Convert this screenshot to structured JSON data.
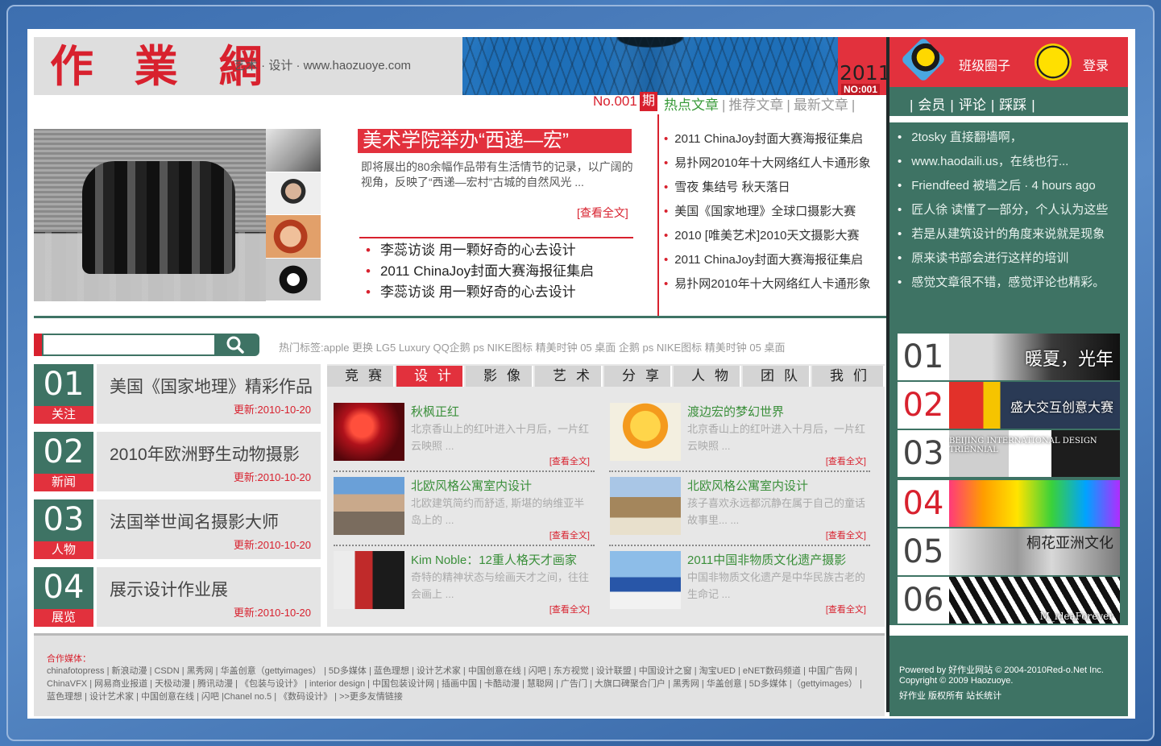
{
  "header": {
    "logo": "作 業 網",
    "tagline": "艺术 · 设计 · www.haozuoye.com",
    "issue_year": "2011",
    "issue_no": "NO:001",
    "club_label": "班级圈子",
    "login_label": "登录"
  },
  "nav": {
    "issue_label": "No.001",
    "qi": "期",
    "links": [
      "热点文章",
      "推荐文章",
      "最新文章"
    ]
  },
  "feature": {
    "title": "美术学院举办“西递—宏”",
    "desc": "即将展出的80余幅作品带有生活情节的记录，以广阔的视角，反映了“西递—宏村”古城的自然风光 ...",
    "more": "[查看全文]",
    "list": [
      "李蕊访谈 用一颗好奇的心去设计",
      "2011 ChinaJoy封面大赛海报征集启",
      "李蕊访谈 用一颗好奇的心去设计"
    ]
  },
  "hot_list": [
    "2011 ChinaJoy封面大赛海报征集启",
    "易扑网2010年十大网络红人卡通形象",
    "雪夜 集结号 秋天落日",
    "美国《国家地理》全球口摄影大赛",
    "2010 [唯美艺术]2010天文摄影大赛",
    "2011 ChinaJoy封面大赛海报征集启",
    "易扑网2010年十大网络红人卡通形象"
  ],
  "member_panel": {
    "tabs": [
      "会员",
      "评论",
      "踩踩"
    ],
    "items": [
      "2tosky 直接翻墙啊，",
      "www.haodaili.us，在线也行...",
      "Friendfeed 被墙之后 · 4 hours ago",
      "匠人徐 读懂了一部分，个人认为这些",
      "若是从建筑设计的角度来说就是现象",
      "原来读书部会进行这样的培训",
      "感觉文章很不错，感觉评论也精彩。"
    ]
  },
  "search": {
    "placeholder": "",
    "hot_tags": "热门标签:apple 更换 LG5 Luxury QQ企鹅 ps NIKE图标 精美时钟 05 桌面 企鹅 ps NIKE图标 精美时钟 05 桌面"
  },
  "numbered": [
    {
      "n": "01",
      "tag": "关注",
      "title": "美国《国家地理》精彩作品",
      "date": "更新:2010-10-20"
    },
    {
      "n": "02",
      "tag": "新闻",
      "title": "2010年欧洲野生动物摄影",
      "date": "更新:2010-10-20"
    },
    {
      "n": "03",
      "tag": "人物",
      "title": "法国举世闻名摄影大师",
      "date": "更新:2010-10-20"
    },
    {
      "n": "04",
      "tag": "展览",
      "title": "展示设计作业展",
      "date": "更新:2010-10-20"
    }
  ],
  "categories": [
    "竞赛",
    "设计",
    "影像",
    "艺术",
    "分享",
    "人物",
    "团队",
    "我们"
  ],
  "cards": [
    {
      "title": "秋枫正红",
      "desc": "北京香山上的红叶进入十月后，一片红云映照 ...",
      "more": "[查看全文]"
    },
    {
      "title": "渡边宏的梦幻世界",
      "desc": "北京香山上的红叶进入十月后，一片红云映照 ...",
      "more": "[查看全文]"
    },
    {
      "title": "北欧风格公寓室内设计",
      "desc": "北欧建筑简约而舒适, 斯堪的纳维亚半岛上的 ...",
      "more": "[查看全文]"
    },
    {
      "title": "北欧风格公寓室内设计",
      "desc": "孩子喜欢永远都沉静在属于自己的童话故事里... ...",
      "more": "[查看全文]"
    },
    {
      "title": "Kim Noble：12重人格天才画家",
      "desc": "奇特的精神状态与绘画天才之间，往往会画上 ...",
      "more": "[查看全文]"
    },
    {
      "title": "2011中国非物质文化遗产摄影",
      "desc": "中国非物质文化遗产是中华民族古老的生命记 ...",
      "more": "[查看全文]"
    }
  ],
  "ranking": [
    {
      "n": "01",
      "label": "暖夏，光年"
    },
    {
      "n": "02",
      "label": "盛大交互创意大赛"
    },
    {
      "n": "03",
      "label": "BEIJING INTERNATIONAL DESIGN TRIENNIAL"
    },
    {
      "n": "04",
      "label": ""
    },
    {
      "n": "05",
      "label": "桐花亚洲文化"
    },
    {
      "n": "06",
      "label": "M_ideaForever"
    }
  ],
  "footer": {
    "partner_title": "合作媒体：",
    "partner_links": "chinafotopress | 新浪动漫 | CSDN | 黑秀网 | 华盖创意（gettyimages） | 5D多媒体 | 蓝色理想 | 设计艺术家 | 中国创意在线 | 闪吧 | 东方视觉 | 设计联盟 | 中国设计之窗 | 淘宝UED | eNET数码频道 | 中国广告网 | ChinaVFX | 网易商业报道 | 天极动漫 | 腾讯动漫 | 《包装与设计》 | interior design | 中国包装设计网 | 插画中国 | 卡酷动漫 | 慧聪网 | 广告门 | 大旗口碑聚合门户 | 黑秀网 | 华盖创意 | 5D多媒体 |（gettyimages） | 蓝色理想 | 设计艺术家 | 中国创意在线 | 闪吧 |Chanel no.5 | 《数码设计》 | >>更多友情链接",
    "powered": "Powered by 好作业网站 © 2004-2010Red-o.Net Inc.",
    "copyright": "Copyright © 2009 Haozuoye.",
    "rights": "好作业 版权所有 站长统计"
  }
}
